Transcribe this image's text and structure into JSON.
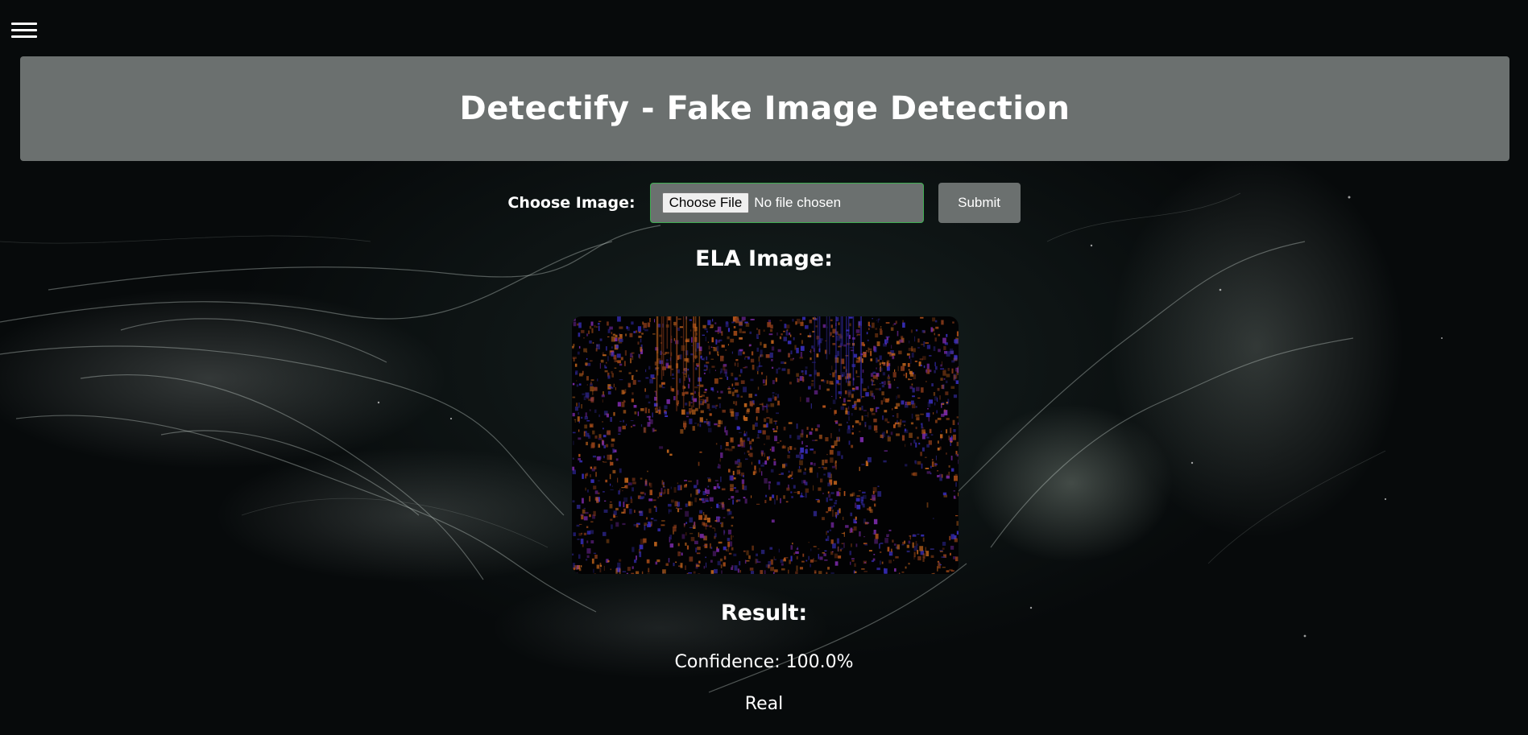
{
  "menu": {
    "icon": "hamburger-menu-icon"
  },
  "header": {
    "title": "Detectify - Fake Image Detection"
  },
  "form": {
    "label": "Choose Image:",
    "file_button_label": "Choose File",
    "file_status": "No file chosen",
    "submit_label": "Submit"
  },
  "ela": {
    "title": "ELA Image:"
  },
  "result": {
    "title": "Result:",
    "confidence": "Confidence: 100.0%",
    "verdict": "Real"
  },
  "colors": {
    "header_bg": "#6b706f",
    "input_border": "#3fae52",
    "text": "#ffffff",
    "ela_orange": "#c0641c",
    "ela_blue": "#3a2fc0",
    "ela_purple": "#7a2aa8"
  }
}
